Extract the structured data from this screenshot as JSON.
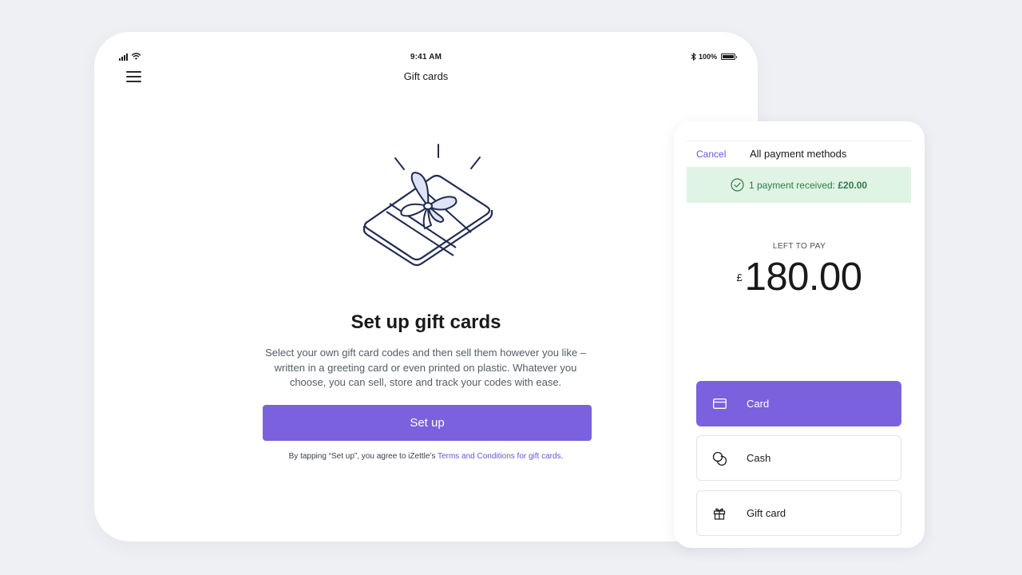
{
  "tablet": {
    "status_bar": {
      "time": "9:41 AM",
      "battery": "100%"
    },
    "nav": {
      "title": "Gift cards"
    },
    "setup": {
      "title": "Set up gift cards",
      "description": "Select your own gift card codes and then sell them however you like – written in a greeting card or even printed on plastic. Whatever you choose, you can sell, store and track your codes with ease.",
      "button_label": "Set up",
      "terms_prefix": "By tapping “Set up”, you agree to iZettle’s ",
      "terms_link": "Terms and Conditions for gift cards",
      "terms_suffix": "."
    }
  },
  "phone": {
    "cancel_label": "Cancel",
    "title": "All payment methods",
    "banner": {
      "text": "1 payment received:",
      "amount": "£20.00"
    },
    "left_to_pay": {
      "label": "LEFT TO PAY",
      "currency": "£",
      "amount": "180.00"
    },
    "payment_methods": [
      {
        "label": "Card",
        "icon": "credit-card-icon",
        "selected": true
      },
      {
        "label": "Cash",
        "icon": "coins-icon",
        "selected": false
      },
      {
        "label": "Gift card",
        "icon": "gift-icon",
        "selected": false
      }
    ]
  },
  "colors": {
    "accent": "#7b61dd",
    "link": "#6a55d8",
    "banner_bg": "#dff4e4",
    "banner_text": "#2f7a47",
    "background": "#eef0f4"
  }
}
